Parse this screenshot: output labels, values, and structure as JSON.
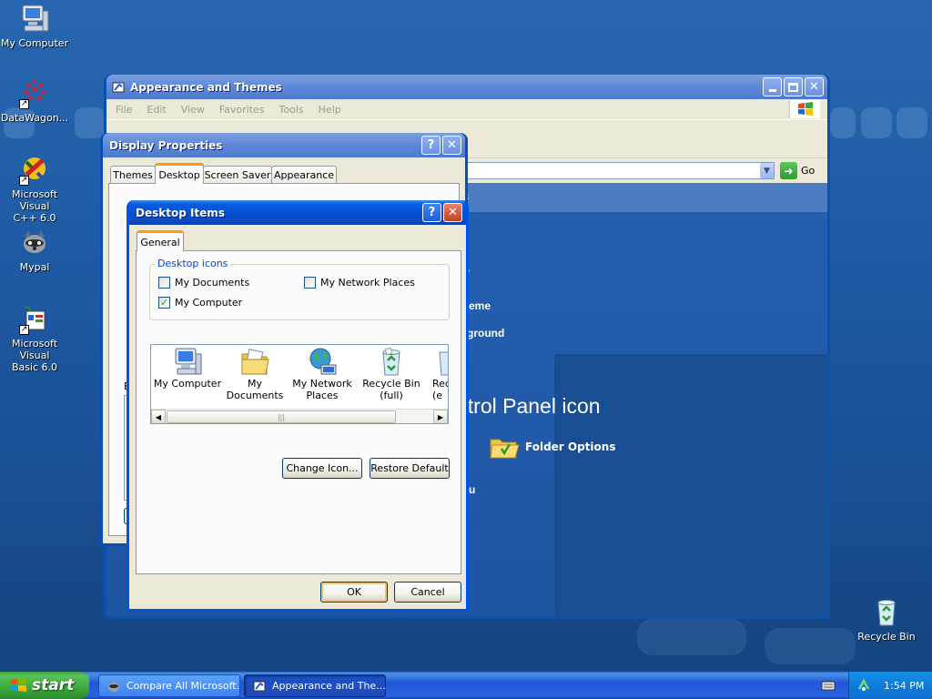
{
  "desktop": {
    "icons": [
      {
        "label": "My Computer"
      },
      {
        "label": "DataWagon..."
      },
      {
        "label_l1": "Microsoft Visual",
        "label_l2": "C++ 6.0"
      },
      {
        "label": "Mypal"
      },
      {
        "label_l1": "Microsoft Visual",
        "label_l2": "Basic 6.0"
      },
      {
        "label": "Recycle Bin"
      }
    ]
  },
  "explorer": {
    "title": "Appearance and Themes",
    "menu": [
      "File",
      "Edit",
      "View",
      "Favorites",
      "Tools",
      "Help"
    ],
    "go_label": "Go",
    "frag_s": "s",
    "frag_comma": ",",
    "frag_theme": "eme",
    "frag_background": "ground",
    "frag_heading": "ntrol Panel icon",
    "folder_options": "Folder Options",
    "frag_u": "u"
  },
  "display_properties": {
    "title": "Display Properties",
    "tabs": [
      "Themes",
      "Desktop",
      "Screen Saver",
      "Appearance"
    ],
    "frag_b": "B"
  },
  "desktop_items": {
    "title": "Desktop Items",
    "tab": "General",
    "group_label": "Desktop icons",
    "checkboxes": [
      {
        "label": "My Documents",
        "checked": false
      },
      {
        "label": "My Network Places",
        "checked": false
      },
      {
        "label": "My Computer",
        "checked": true
      }
    ],
    "icon_list": [
      {
        "label_l1": "My Computer",
        "label_l2": ""
      },
      {
        "label_l1": "My Documents",
        "label_l2": ""
      },
      {
        "label_l1": "My Network",
        "label_l2": "Places"
      },
      {
        "label_l1": "Recycle Bin",
        "label_l2": "(full)"
      },
      {
        "label_l1": "Rec",
        "label_l2": "(e"
      }
    ],
    "change_icon_button": "Change Icon...",
    "restore_default_button": "Restore Default",
    "ok_button": "OK",
    "cancel_button": "Cancel"
  },
  "taskbar": {
    "start_label": "start",
    "tasks": [
      "Compare All Microsoft...",
      "Appearance and The..."
    ],
    "clock": "1:54 PM"
  },
  "colors": {
    "accent": "#0a5ce0",
    "desktop": "#1f5ca6",
    "start": "#3aa83a"
  }
}
